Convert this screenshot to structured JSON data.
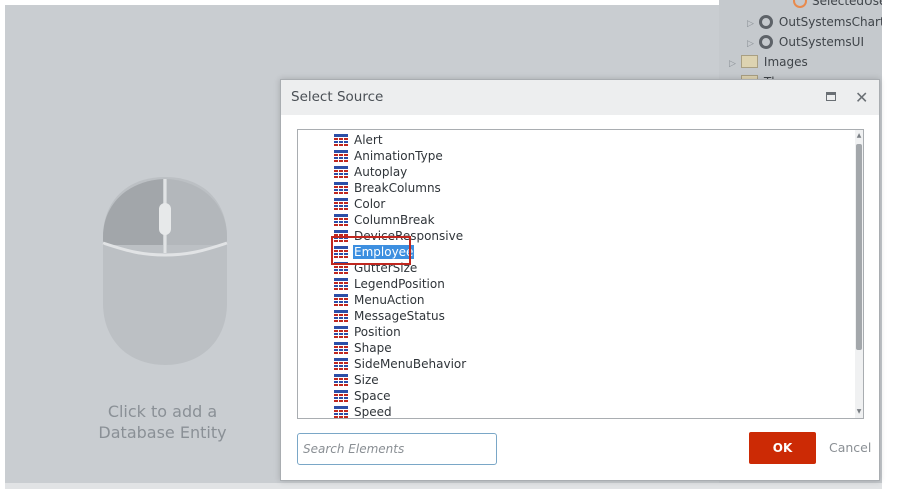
{
  "canvas": {
    "hint_line1": "Click to add a",
    "hint_line2": "Database Entity"
  },
  "tree": {
    "items": [
      {
        "label": "SelectedUser",
        "icon": "orange-circle-icon"
      },
      {
        "label": "OutSystemsCharts",
        "icon": "module-icon"
      },
      {
        "label": "OutSystemsUI",
        "icon": "module-icon"
      },
      {
        "label": "Images",
        "icon": "folder-icon"
      },
      {
        "label": "Th",
        "icon": "folder-icon"
      }
    ]
  },
  "dialog": {
    "title": "Select Source",
    "items": [
      "Alert",
      "AnimationType",
      "Autoplay",
      "BreakColumns",
      "Color",
      "ColumnBreak",
      "DeviceResponsive",
      "Employee",
      "GutterSize",
      "LegendPosition",
      "MenuAction",
      "MessageStatus",
      "Position",
      "Shape",
      "SideMenuBehavior",
      "Size",
      "Space",
      "Speed"
    ],
    "selected_item": "Employee",
    "search_placeholder": "Search Elements",
    "ok_label": "OK",
    "cancel_label": "Cancel"
  },
  "colors": {
    "canvas_bg": "#c9cdd1",
    "selection": "#3d8fe0",
    "highlight_outline": "#c0271f",
    "ok_button": "#cc2a05"
  }
}
